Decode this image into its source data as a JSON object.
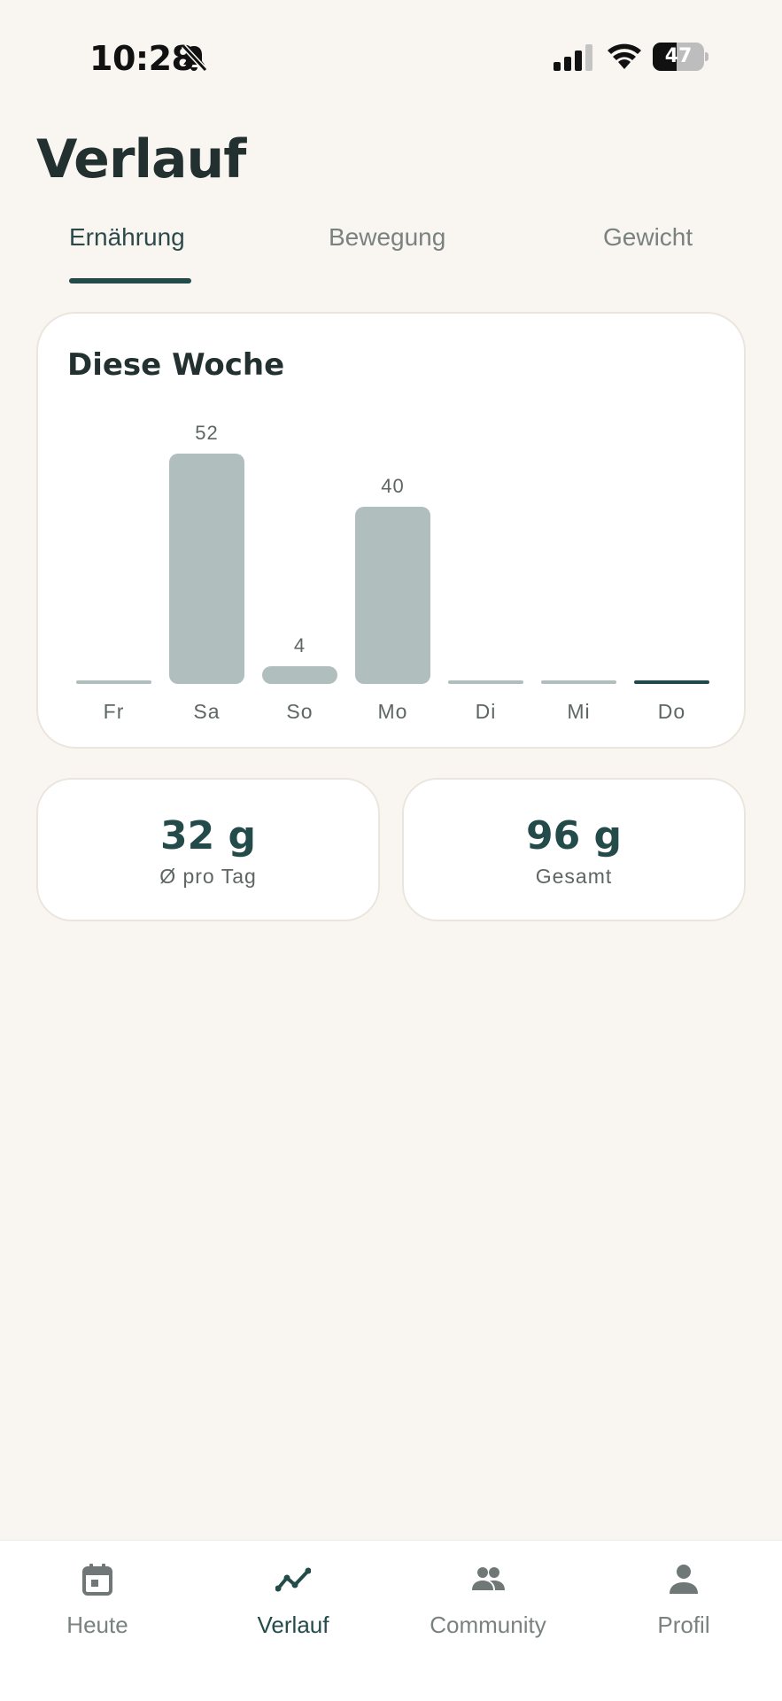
{
  "status_bar": {
    "time": "10:28",
    "battery_percent": 47,
    "battery_label": "47"
  },
  "page": {
    "title": "Verlauf"
  },
  "tabs": [
    {
      "label": "Ernährung",
      "active": true
    },
    {
      "label": "Bewegung",
      "active": false
    },
    {
      "label": "Gewicht",
      "active": false
    }
  ],
  "chart_card": {
    "title": "Diese Woche"
  },
  "chart_data": {
    "type": "bar",
    "title": "Diese Woche",
    "categories": [
      "Fr",
      "Sa",
      "So",
      "Mo",
      "Di",
      "Mi",
      "Do"
    ],
    "values": [
      0,
      52,
      4,
      40,
      0,
      0,
      0
    ],
    "value_labels": [
      "",
      "52",
      "4",
      "40",
      "",
      "",
      ""
    ],
    "highlight_category": "Do",
    "ylim": [
      0,
      52
    ],
    "grid": false,
    "legend": "none",
    "colors": {
      "bar": "#b0bfbd",
      "highlight": "#1f4a49"
    }
  },
  "stats": [
    {
      "value": "32 g",
      "label": "Ø pro Tag"
    },
    {
      "value": "96 g",
      "label": "Gesamt"
    }
  ],
  "bottom_nav": [
    {
      "label": "Heute",
      "icon": "calendar-icon",
      "active": false
    },
    {
      "label": "Verlauf",
      "icon": "trend-line-icon",
      "active": true
    },
    {
      "label": "Community",
      "icon": "people-icon",
      "active": false
    },
    {
      "label": "Profil",
      "icon": "person-icon",
      "active": false
    }
  ],
  "colors": {
    "background": "#f9f6f2",
    "accent": "#234b4a",
    "muted_text": "#7a8280",
    "card_border": "#ebe5dd"
  }
}
